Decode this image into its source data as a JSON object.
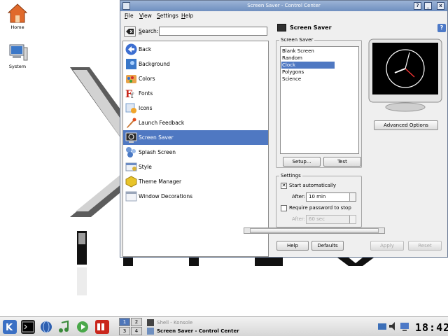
{
  "desktop": {
    "icons": [
      {
        "label": "Home"
      },
      {
        "label": "System"
      }
    ]
  },
  "window": {
    "title": "Screen Saver - Control Center",
    "buttons": {
      "help": "?",
      "minimize": "_",
      "close": "x"
    },
    "menu": [
      {
        "label": "File",
        "accel": "F",
        "rest": "ile"
      },
      {
        "label": "View",
        "accel": "V",
        "rest": "iew"
      },
      {
        "label": "Settings",
        "accel": "S",
        "rest": "ettings"
      },
      {
        "label": "Help",
        "accel": "H",
        "rest": "elp"
      }
    ],
    "search": {
      "label_accel": "S",
      "label_rest": "e",
      "label_accel2": "a",
      "label_tail": "rch:",
      "value": ""
    },
    "modules": [
      {
        "label": "Back",
        "icon": "back-arrow-icon",
        "color": "#3d6fd1"
      },
      {
        "label": "Background",
        "icon": "background-icon",
        "color": "#3a78c9"
      },
      {
        "label": "Colors",
        "icon": "colors-icon",
        "color": "#e9a34a"
      },
      {
        "label": "Fonts",
        "icon": "fonts-icon",
        "color": "#c8271c"
      },
      {
        "label": "Icons",
        "icon": "icons-icon",
        "color": "#7ba0cf"
      },
      {
        "label": "Launch Feedback",
        "icon": "launch-feedback-icon",
        "color": "#c97733"
      },
      {
        "label": "Screen Saver",
        "icon": "screen-saver-icon",
        "color": "#2c2c2c",
        "selected": true
      },
      {
        "label": "Splash Screen",
        "icon": "splash-screen-icon",
        "color": "#6c96d6"
      },
      {
        "label": "Style",
        "icon": "style-icon",
        "color": "#d8b23a"
      },
      {
        "label": "Theme Manager",
        "icon": "theme-manager-icon",
        "color": "#e8c42a"
      },
      {
        "label": "Window Decorations",
        "icon": "window-decorations-icon",
        "color": "#9aa6ba"
      }
    ],
    "panel": {
      "title": "Screen Saver",
      "help": "?",
      "screensaver_group": "Screen Saver",
      "savers": [
        {
          "label": "Blank Screen"
        },
        {
          "label": "Random"
        },
        {
          "label": "Clock",
          "selected": true
        },
        {
          "label": "Polygons"
        },
        {
          "label": "Science"
        }
      ],
      "setup_button": "Setup...",
      "test_button": "Test",
      "advanced_button": "Advanced Options",
      "settings_group": "Settings",
      "start_auto": {
        "label": "Start automatically",
        "checked": true
      },
      "after_label": "After:",
      "after_value": "10 min",
      "require_pwd": {
        "label": "Require password to stop",
        "checked": false
      },
      "after2_label": "After:",
      "after2_value": "60 sec",
      "help_button": "Help",
      "defaults_button": "Defaults",
      "apply_button": "Apply",
      "reset_button": "Reset"
    }
  },
  "taskbar": {
    "pager": [
      "1",
      "2",
      "3",
      "4"
    ],
    "tasks": [
      {
        "label": "Shell - Konsole",
        "active": false
      },
      {
        "label": "Screen Saver - Control Center",
        "active": true
      }
    ],
    "clock": "18:42"
  },
  "colors": {
    "selection": "#4f78c2",
    "title_gradient_top": "#9bb3d6",
    "title_gradient_bottom": "#6f8fbf"
  }
}
